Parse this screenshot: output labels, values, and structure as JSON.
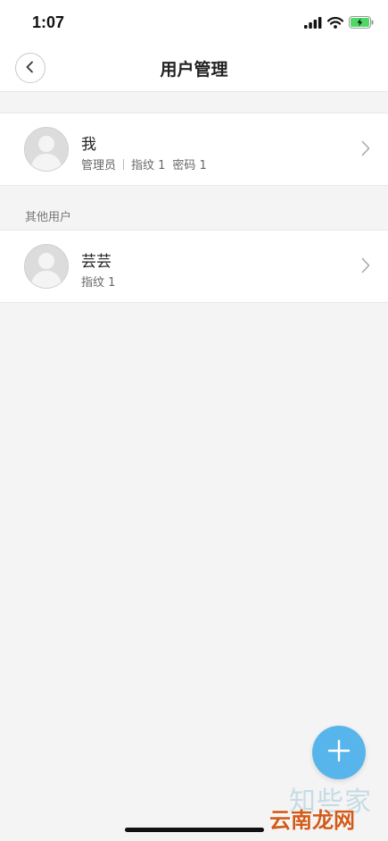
{
  "status_bar": {
    "time": "1:07",
    "icons": [
      "signal-icon",
      "wifi-icon",
      "battery-charging-icon"
    ],
    "battery_color": "#4cd964"
  },
  "header": {
    "title": "用户管理",
    "back_icon": "chevron-left-icon"
  },
  "me": {
    "name": "我",
    "role": "管理员",
    "fingerprint": "指纹 1",
    "password": "密码 1"
  },
  "other_users": {
    "label": "其他用户",
    "items": [
      {
        "name": "芸芸",
        "fingerprint": "指纹 1"
      }
    ]
  },
  "fab": {
    "icon": "plus-icon",
    "color": "#58b5ec"
  },
  "watermark": {
    "line1": "知些家",
    "line2": "云南龙网"
  }
}
